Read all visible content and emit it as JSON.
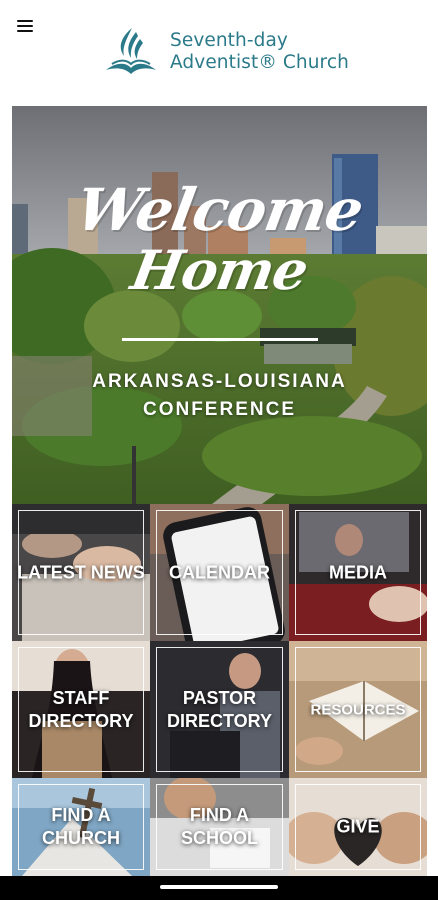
{
  "header": {
    "menu_icon": "hamburger-menu-icon",
    "logo_icon": "flame-book-logo",
    "logo_line1": "Seventh-day",
    "logo_line2": "Adventist® Church",
    "brand_color": "#2b7a8a"
  },
  "hero": {
    "welcome_line1": "Welcome",
    "welcome_line2": "Home",
    "conference_line1": "ARKANSAS-LOUISIANA",
    "conference_line2": "CONFERENCE"
  },
  "tiles": [
    {
      "label": "LATEST NEWS"
    },
    {
      "label": "CALENDAR"
    },
    {
      "label": "MEDIA"
    },
    {
      "label": "STAFF DIRECTORY"
    },
    {
      "label": "PASTOR DIRECTORY"
    },
    {
      "label": "RESOURCES"
    },
    {
      "label": "FIND A CHURCH"
    },
    {
      "label": "FIND A SCHOOL"
    },
    {
      "label": "GIVE"
    }
  ]
}
